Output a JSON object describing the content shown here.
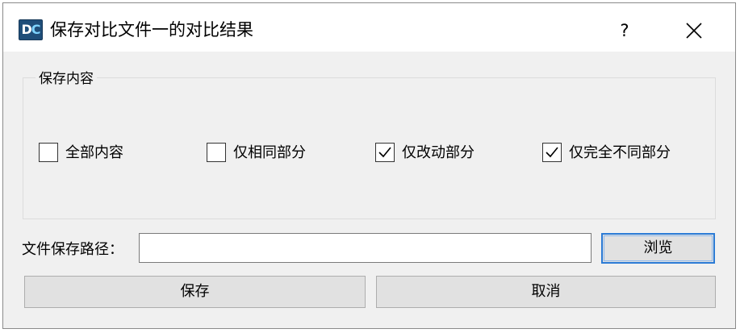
{
  "window": {
    "icon_text": "DC",
    "title": "保存对比文件一的对比结果",
    "help_label": "?",
    "close_icon": "close-icon"
  },
  "group": {
    "legend": "保存内容",
    "options": [
      {
        "label": "全部内容",
        "checked": false
      },
      {
        "label": "仅相同部分",
        "checked": false
      },
      {
        "label": "仅改动部分",
        "checked": true
      },
      {
        "label": "仅完全不同部分",
        "checked": true
      }
    ]
  },
  "path": {
    "label": "文件保存路径：",
    "value": "",
    "browse_label": "浏览"
  },
  "buttons": {
    "save_label": "保存",
    "cancel_label": "取消"
  },
  "colors": {
    "dialog_bg": "#f0f0f0",
    "titlebar_bg": "#ffffff",
    "focus_border": "#2b7bd6",
    "button_bg": "#e1e1e1"
  }
}
